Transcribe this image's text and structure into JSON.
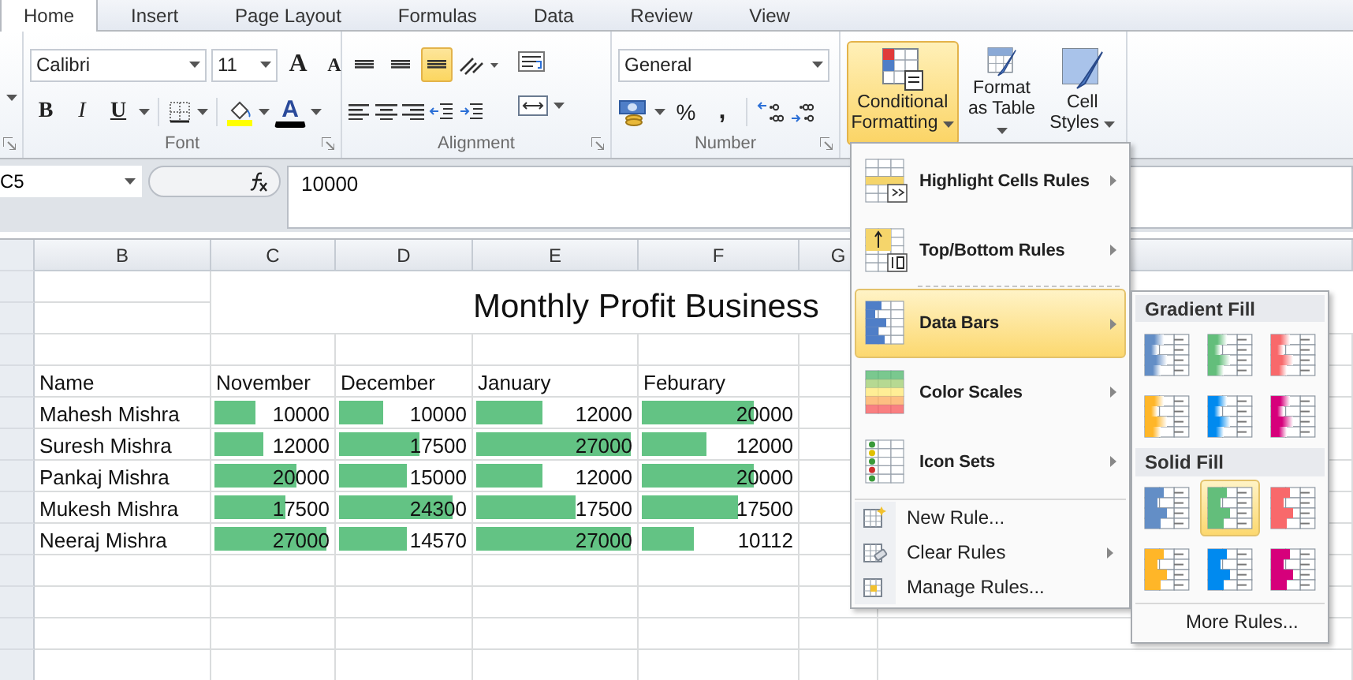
{
  "tabs": [
    {
      "label": "Home",
      "selected": true
    },
    {
      "label": "Insert",
      "selected": false
    },
    {
      "label": "Page Layout",
      "selected": false
    },
    {
      "label": "Formulas",
      "selected": false
    },
    {
      "label": "Data",
      "selected": false
    },
    {
      "label": "Review",
      "selected": false
    },
    {
      "label": "View",
      "selected": false
    }
  ],
  "ribbon": {
    "font": {
      "label": "Font",
      "font_name": "Calibri",
      "font_size": "11",
      "grow": "A",
      "shrink": "A",
      "bold": "B",
      "italic": "I",
      "underline": "U",
      "font_color": "A"
    },
    "alignment": {
      "label": "Alignment",
      "vertical": [
        {
          "selected": false
        },
        {
          "selected": false
        },
        {
          "selected": true
        }
      ]
    },
    "number": {
      "label": "Number",
      "format": "General",
      "percent": "%",
      "comma": ","
    },
    "styles": [
      {
        "label": "Conditional Formatting",
        "selected": true
      },
      {
        "label": "Format as Table",
        "selected": false
      },
      {
        "label": "Cell Styles",
        "selected": false
      }
    ]
  },
  "formula_bar": {
    "name_box": "C5",
    "value": "10000"
  },
  "sheet": {
    "columns": [
      "B",
      "C",
      "D",
      "E",
      "F",
      "G"
    ],
    "title": "Monthly Profit Business",
    "header": [
      "Name",
      "November",
      "December",
      "January",
      "Feburary"
    ],
    "rows": [
      {
        "name": "Mahesh Mishra",
        "cells": [
          {
            "value": "10000",
            "level": 0.37
          },
          {
            "value": "10000",
            "level": 0.36
          },
          {
            "value": "12000",
            "level": 0.43
          },
          {
            "value": "20000",
            "level": 0.73
          }
        ]
      },
      {
        "name": "Suresh Mishra",
        "cells": [
          {
            "value": "12000",
            "level": 0.43
          },
          {
            "value": "17500",
            "level": 0.63
          },
          {
            "value": "27000",
            "level": 0.97
          },
          {
            "value": "12000",
            "level": 0.44
          }
        ]
      },
      {
        "name": "Pankaj Mishra",
        "cells": [
          {
            "value": "20000",
            "level": 0.71
          },
          {
            "value": "15000",
            "level": 0.54
          },
          {
            "value": "12000",
            "level": 0.43
          },
          {
            "value": "20000",
            "level": 0.73
          }
        ]
      },
      {
        "name": "Mukesh Mishra",
        "cells": [
          {
            "value": "17500",
            "level": 0.62
          },
          {
            "value": "24300",
            "level": 0.87
          },
          {
            "value": "17500",
            "level": 0.63
          },
          {
            "value": "17500",
            "level": 0.63
          }
        ]
      },
      {
        "name": "Neeraj Mishra",
        "cells": [
          {
            "value": "27000",
            "level": 0.95
          },
          {
            "value": "14570",
            "level": 0.53
          },
          {
            "value": "27000",
            "level": 0.97
          },
          {
            "value": "10112",
            "level": 0.36
          }
        ]
      }
    ]
  },
  "menu": {
    "items": [
      {
        "kind": "large",
        "label": "Highlight Cells Rules",
        "submenu": true,
        "selected": false
      },
      {
        "kind": "large",
        "label": "Top/Bottom Rules",
        "submenu": true,
        "selected": false
      },
      {
        "kind": "large",
        "label": "Data Bars",
        "submenu": true,
        "selected": true
      },
      {
        "kind": "large",
        "label": "Color Scales",
        "submenu": true,
        "selected": false
      },
      {
        "kind": "large",
        "label": "Icon Sets",
        "submenu": true,
        "selected": false
      },
      {
        "kind": "small",
        "label": "New Rule...",
        "submenu": false,
        "selected": false
      },
      {
        "kind": "small",
        "label": "Clear Rules",
        "submenu": true,
        "selected": false
      },
      {
        "kind": "small",
        "label": "Manage Rules...",
        "submenu": false,
        "selected": false
      }
    ]
  },
  "submenu": {
    "sections": [
      {
        "title": "Gradient Fill",
        "gradient": true,
        "swatches": [
          {
            "color": "#638ec6",
            "selected": false
          },
          {
            "color": "#63be7b",
            "selected": false
          },
          {
            "color": "#f8696b",
            "selected": false
          },
          {
            "color": "#ffb628",
            "selected": false
          },
          {
            "color": "#008aef",
            "selected": false
          },
          {
            "color": "#d6007b",
            "selected": false
          }
        ]
      },
      {
        "title": "Solid Fill",
        "gradient": false,
        "swatches": [
          {
            "color": "#638ec6",
            "selected": false
          },
          {
            "color": "#63be7b",
            "selected": true
          },
          {
            "color": "#f8696b",
            "selected": false
          },
          {
            "color": "#ffb628",
            "selected": false
          },
          {
            "color": "#008aef",
            "selected": false
          },
          {
            "color": "#d6007b",
            "selected": false
          }
        ]
      }
    ],
    "more": "More Rules..."
  }
}
